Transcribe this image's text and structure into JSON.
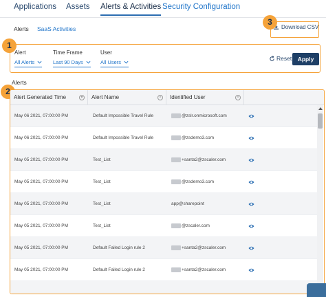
{
  "top_tabs": [
    {
      "label": "Applications"
    },
    {
      "label": "Assets"
    },
    {
      "label": "Alerts & Activities"
    },
    {
      "label": "Security Configuration"
    }
  ],
  "sub_tabs": [
    {
      "label": "Alerts"
    },
    {
      "label": "SaaS Activities"
    }
  ],
  "callouts": [
    "1",
    "2",
    "3"
  ],
  "download_label": "Download CSV",
  "filters": {
    "alert": {
      "label": "Alert",
      "value": "All Alerts"
    },
    "time_frame": {
      "label": "Time Frame",
      "value": "Last 90 Days"
    },
    "user": {
      "label": "User",
      "value": "All Users"
    }
  },
  "reset_label": "Reset",
  "apply_label": "Apply",
  "section_title": "Alerts",
  "columns": [
    "Alert Generated Time",
    "Alert Name",
    "Identified User"
  ],
  "rows": [
    {
      "time": "May 06 2021, 07:00:00 PM",
      "name": "Default Impossible Travel Rule",
      "user": "@zslr.onmicrosoft.com",
      "masked": true
    },
    {
      "time": "May 06 2021, 07:00:00 PM",
      "name": "Default Impossible Travel Rule",
      "user": "@zsdemo3.com",
      "masked": true
    },
    {
      "time": "May 05 2021, 07:00:00 PM",
      "name": "Test_List",
      "user": "+santa2@zscaler.com",
      "masked": true
    },
    {
      "time": "May 05 2021, 07:00:00 PM",
      "name": "Test_List",
      "user": "@zsdemo3.com",
      "masked": true
    },
    {
      "time": "May 05 2021, 07:00:00 PM",
      "name": "Test_List",
      "user": "app@sharepoint",
      "masked": false
    },
    {
      "time": "May 05 2021, 07:00:00 PM",
      "name": "Test_List",
      "user": "@zscaler.com",
      "masked": true
    },
    {
      "time": "May 05 2021, 07:00:00 PM",
      "name": "Default Failed Login rule 2",
      "user": "+santa2@zscaler.com",
      "masked": true
    },
    {
      "time": "May 05 2021, 07:00:00 PM",
      "name": "Default Failed Login rule 2",
      "user": "+santa2@zscaler.com",
      "masked": true
    },
    {
      "time": "",
      "name": "",
      "user": "",
      "masked": false
    }
  ],
  "colors": {
    "accent": "#1f74c9",
    "callout": "#f5a33a",
    "apply": "#1e3f66"
  }
}
